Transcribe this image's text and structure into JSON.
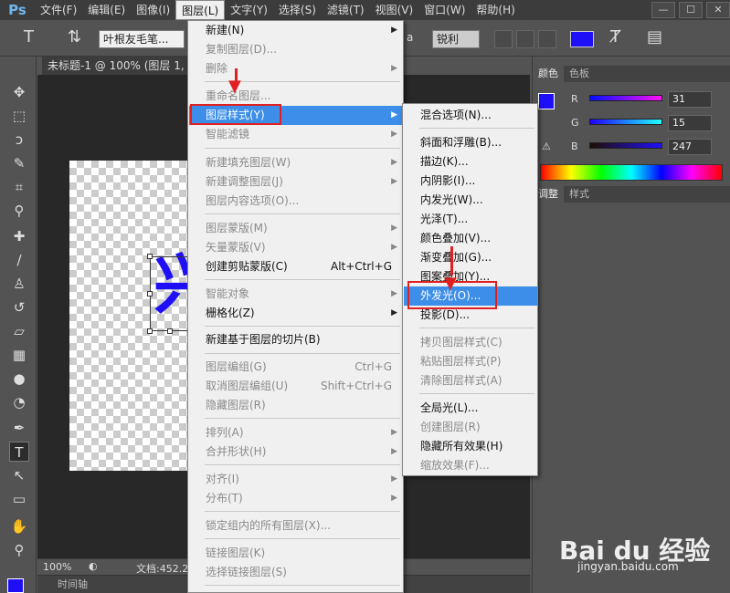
{
  "app": {
    "logo": "Ps",
    "menus": [
      "文件(F)",
      "编辑(E)",
      "图像(I)",
      "图层(L)",
      "文字(Y)",
      "选择(S)",
      "滤镜(T)",
      "视图(V)",
      "窗口(W)",
      "帮助(H)"
    ],
    "active_menu": "图层(L)"
  },
  "options": {
    "font_name": "叶根友毛笔...",
    "aa_label": "a",
    "aa_mode": "锐利",
    "text_color": "#1f0ff7"
  },
  "document": {
    "tab_title": "未标题-1 @ 100% (图层 1, R",
    "zoom": "100%",
    "doc_info": "文档:452.2",
    "timeline_label": "时间轴",
    "glyph": "兴"
  },
  "color_panel": {
    "tabs": [
      "颜色",
      "色板"
    ],
    "r_label": "R",
    "r_value": "31",
    "g_label": "G",
    "g_value": "15",
    "b_label": "B",
    "b_value": "247",
    "fg_color": "#1f0ff7"
  },
  "adjust_panel": {
    "tabs": [
      "调整",
      "样式"
    ]
  },
  "layer_menu": {
    "items": [
      {
        "label": "新建(N)",
        "arrow": true,
        "disabled": false
      },
      {
        "label": "复制图层(D)...",
        "disabled": true
      },
      {
        "label": "删除",
        "arrow": true,
        "disabled": true
      },
      {
        "label": "重命名图层...",
        "disabled": true
      },
      {
        "label": "图层样式(Y)",
        "arrow": true,
        "highlight": true
      },
      {
        "label": "智能滤镜",
        "arrow": true,
        "disabled": true
      },
      {
        "label": "新建填充图层(W)",
        "arrow": true,
        "disabled": true
      },
      {
        "label": "新建调整图层(J)",
        "arrow": true,
        "disabled": true
      },
      {
        "label": "图层内容选项(O)...",
        "disabled": true
      },
      {
        "label": "图层蒙版(M)",
        "arrow": true,
        "disabled": true
      },
      {
        "label": "矢量蒙版(V)",
        "arrow": true,
        "disabled": true
      },
      {
        "label": "创建剪贴蒙版(C)",
        "shortcut": "Alt+Ctrl+G",
        "disabled": false
      },
      {
        "label": "智能对象",
        "arrow": true,
        "disabled": true
      },
      {
        "label": "栅格化(Z)",
        "arrow": true,
        "disabled": false
      },
      {
        "label": "新建基于图层的切片(B)",
        "disabled": false
      },
      {
        "label": "图层编组(G)",
        "shortcut": "Ctrl+G",
        "disabled": true
      },
      {
        "label": "取消图层编组(U)",
        "shortcut": "Shift+Ctrl+G",
        "disabled": true
      },
      {
        "label": "隐藏图层(R)",
        "disabled": true
      },
      {
        "label": "排列(A)",
        "arrow": true,
        "disabled": true
      },
      {
        "label": "合并形状(H)",
        "arrow": true,
        "disabled": true
      },
      {
        "label": "对齐(I)",
        "arrow": true,
        "disabled": true
      },
      {
        "label": "分布(T)",
        "arrow": true,
        "disabled": true
      },
      {
        "label": "锁定组内的所有图层(X)...",
        "disabled": true
      },
      {
        "label": "链接图层(K)",
        "disabled": true
      },
      {
        "label": "选择链接图层(S)",
        "disabled": true
      }
    ]
  },
  "style_submenu": {
    "items": [
      {
        "label": "混合选项(N)...",
        "disabled": false
      },
      {
        "label": "斜面和浮雕(B)...",
        "disabled": false
      },
      {
        "label": "描边(K)...",
        "disabled": false
      },
      {
        "label": "内阴影(I)...",
        "disabled": false
      },
      {
        "label": "内发光(W)...",
        "disabled": false
      },
      {
        "label": "光泽(T)...",
        "disabled": false
      },
      {
        "label": "颜色叠加(V)...",
        "disabled": false
      },
      {
        "label": "渐变叠加(G)...",
        "disabled": false
      },
      {
        "label": "图案叠加(Y)...",
        "disabled": false
      },
      {
        "label": "外发光(O)...",
        "highlight": true
      },
      {
        "label": "投影(D)...",
        "disabled": false
      },
      {
        "label": "拷贝图层样式(C)",
        "disabled": true
      },
      {
        "label": "粘贴图层样式(P)",
        "disabled": true
      },
      {
        "label": "清除图层样式(A)",
        "disabled": true
      },
      {
        "label": "全局光(L)...",
        "disabled": false
      },
      {
        "label": "创建图层(R)",
        "disabled": true
      },
      {
        "label": "隐藏所有效果(H)",
        "disabled": false
      },
      {
        "label": "缩放效果(F)...",
        "disabled": true
      }
    ]
  },
  "watermark": {
    "brand": "Bai du 经验",
    "url": "jingyan.baidu.com"
  }
}
